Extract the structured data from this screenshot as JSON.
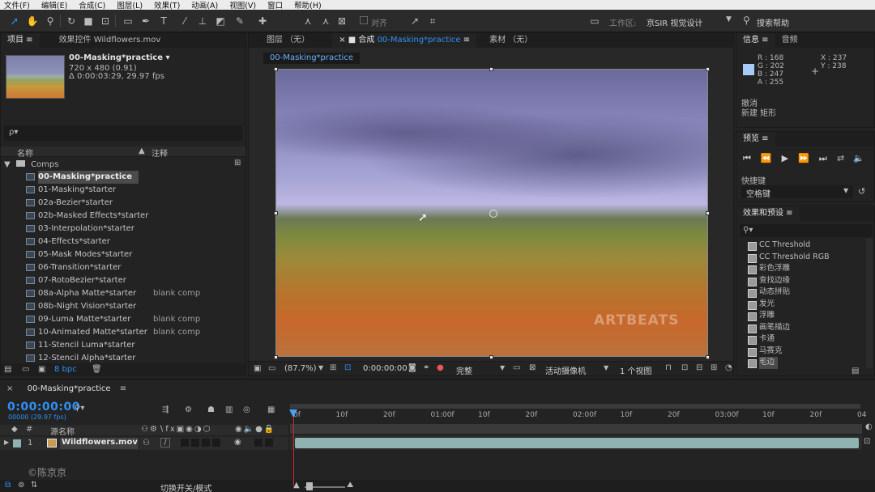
{
  "menubar": [
    "文件(F)",
    "编辑(E)",
    "合成(C)",
    "图层(L)",
    "效果(T)",
    "动画(A)",
    "视图(V)",
    "窗口",
    "帮助(H)"
  ],
  "toolbar": {
    "align_label": "对齐",
    "workspace_label": "工作区:",
    "workspace_value": "京SIR 视觉设计",
    "search_help": "搜索帮助"
  },
  "project_panel": {
    "tab_project": "项目",
    "tab_effect_controls": "效果控件 Wildflowers.mov",
    "comp_name": "00-Masking*practice",
    "comp_dims": "720 x 480 (0.91)",
    "comp_duration": "Δ 0:00:03:29, 29.97 fps",
    "search_placeholder": "ρ▾",
    "col_name": "名称",
    "col_comment": "注释",
    "folder": "Comps",
    "items": [
      {
        "name": "00-Masking*practice",
        "comment": ""
      },
      {
        "name": "01-Masking*starter",
        "comment": ""
      },
      {
        "name": "02a-Bezier*starter",
        "comment": ""
      },
      {
        "name": "02b-Masked Effects*starter",
        "comment": ""
      },
      {
        "name": "03-Interpolation*starter",
        "comment": ""
      },
      {
        "name": "04-Effects*starter",
        "comment": ""
      },
      {
        "name": "05-Mask Modes*starter",
        "comment": ""
      },
      {
        "name": "06-Transition*starter",
        "comment": ""
      },
      {
        "name": "07-RotoBezier*starter",
        "comment": ""
      },
      {
        "name": "08a-Alpha Matte*starter",
        "comment": "blank comp"
      },
      {
        "name": "08b-Night Vision*starter",
        "comment": ""
      },
      {
        "name": "09-Luma Matte*starter",
        "comment": "blank comp"
      },
      {
        "name": "10-Animated Matte*starter",
        "comment": "blank comp"
      },
      {
        "name": "11-Stencil Luma*starter",
        "comment": ""
      },
      {
        "name": "12-Stencil Alpha*starter",
        "comment": ""
      }
    ],
    "bpc": "8 bpc"
  },
  "viewer": {
    "tab_layer": "图层 （无）",
    "tab_comp_prefix": "合成",
    "tab_comp_name": "00-Masking*practice",
    "tab_footage": "素材 （无）",
    "breadcrumb": "00-Masking*practice",
    "watermark": "ARTBEATS",
    "zoom": "(87.7%)",
    "timecode": "0:00:00:00",
    "resolution": "完整",
    "camera": "活动摄像机",
    "views": "1 个视图"
  },
  "info_panel": {
    "tab_info": "信息",
    "tab_audio": "音频",
    "r": "R : 168",
    "g": "G : 202",
    "b": "B : 247",
    "a": "A : 255",
    "x": "X : 237",
    "y": "Y : 238",
    "undo": "撤消",
    "new_rect": "新建 矩形",
    "swatch_color": "#a8caf7"
  },
  "preview_panel": {
    "title": "预览",
    "shortcut_label": "快捷键",
    "shortcut_value": "空格键"
  },
  "effects_panel": {
    "title": "效果和预设",
    "items": [
      "CC Threshold",
      "CC Threshold RGB",
      "彩色浮雕",
      "查找边缘",
      "动态拼贴",
      "发光",
      "浮雕",
      "画笔描边",
      "卡通",
      "马赛克",
      "毛边"
    ]
  },
  "timeline": {
    "comp_tab": "00-Masking*practice",
    "timecode": "0:00:00:00",
    "frame_info": "00000 (29.97 fps)",
    "col_source": "源名称",
    "layer_index": "1",
    "layer_name": "Wildflowers.mov",
    "ruler": [
      "0f",
      "10f",
      "20f",
      "01:00f",
      "10f",
      "20f",
      "02:00f",
      "10f",
      "20f",
      "03:00f",
      "10f",
      "20f",
      "04"
    ],
    "switch_mode": "切换开关/模式",
    "credit": "©陈京京"
  },
  "colors": {
    "accent": "#2f8ff5",
    "layer_clip": "#8fb3b0",
    "playhead": "#d22b2b"
  }
}
